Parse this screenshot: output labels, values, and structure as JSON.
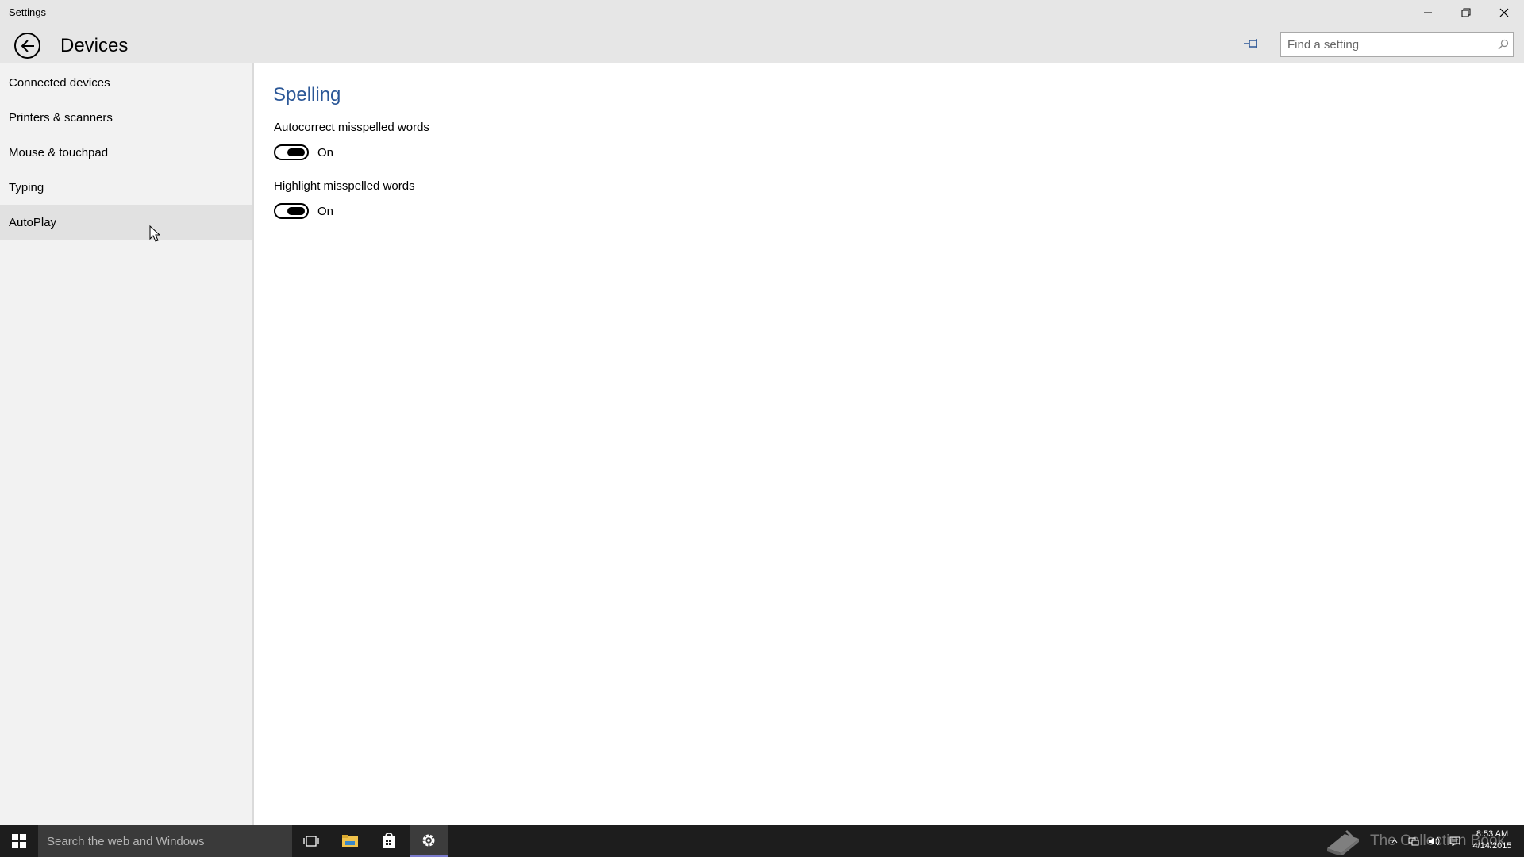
{
  "window": {
    "title": "Settings",
    "page_title": "Devices",
    "search_placeholder": "Find a setting"
  },
  "sidebar": {
    "items": [
      {
        "label": "Connected devices"
      },
      {
        "label": "Printers & scanners"
      },
      {
        "label": "Mouse & touchpad"
      },
      {
        "label": "Typing"
      },
      {
        "label": "AutoPlay"
      }
    ]
  },
  "main": {
    "section_title": "Spelling",
    "settings": [
      {
        "label": "Autocorrect misspelled words",
        "state": "On"
      },
      {
        "label": "Highlight misspelled words",
        "state": "On"
      }
    ]
  },
  "taskbar": {
    "search_placeholder": "Search the web and Windows",
    "watermark": "The Collection Book",
    "time": "8:53 AM",
    "date": "4/14/2015"
  },
  "colors": {
    "accent": "#2b5797",
    "titlebar_bg": "#e6e6e6",
    "sidebar_bg": "#f2f2f2",
    "taskbar_bg": "#1d1d1d"
  }
}
